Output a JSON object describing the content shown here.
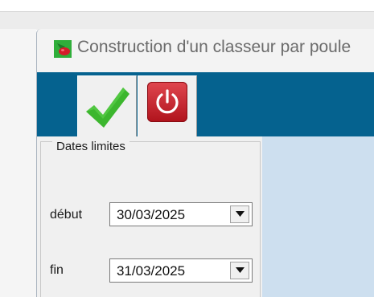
{
  "window": {
    "title": "Construction d'un classeur par poule",
    "icon": "app-cherry-icon"
  },
  "toolbar": {
    "ok_icon": "checkmark-icon",
    "quit_icon": "power-icon",
    "ok_color": "#3cb62e",
    "quit_color": "#c41a22",
    "background": "#05628f"
  },
  "dates_panel": {
    "legend": "Dates limites",
    "start_label": "début",
    "start_value": "30/03/2025",
    "end_label": "fin",
    "end_value": "31/03/2025"
  }
}
